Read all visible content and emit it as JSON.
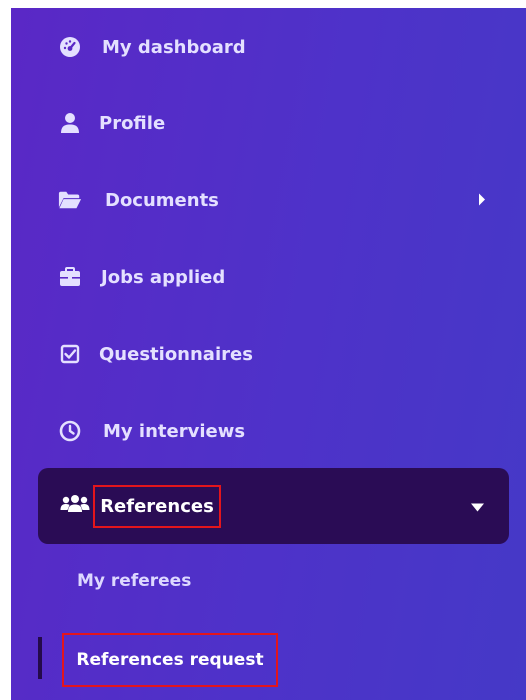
{
  "sidebar": {
    "items": [
      {
        "label": "My dashboard",
        "icon": "dashboard-icon"
      },
      {
        "label": "Profile",
        "icon": "user-icon"
      },
      {
        "label": "Documents",
        "icon": "folder-open-icon"
      },
      {
        "label": "Jobs applied",
        "icon": "briefcase-icon"
      },
      {
        "label": "Questionnaires",
        "icon": "checkbox-icon"
      },
      {
        "label": "My interviews",
        "icon": "clock-icon"
      }
    ],
    "active": {
      "label": "References",
      "icon": "users-icon"
    },
    "subitems": [
      {
        "label": "My referees"
      },
      {
        "label": "References request"
      }
    ]
  },
  "colors": {
    "sidebar_start": "#5a28c6",
    "sidebar_end": "#4539c7",
    "active_bg": "#2a0c55",
    "highlight": "#e3151c"
  }
}
